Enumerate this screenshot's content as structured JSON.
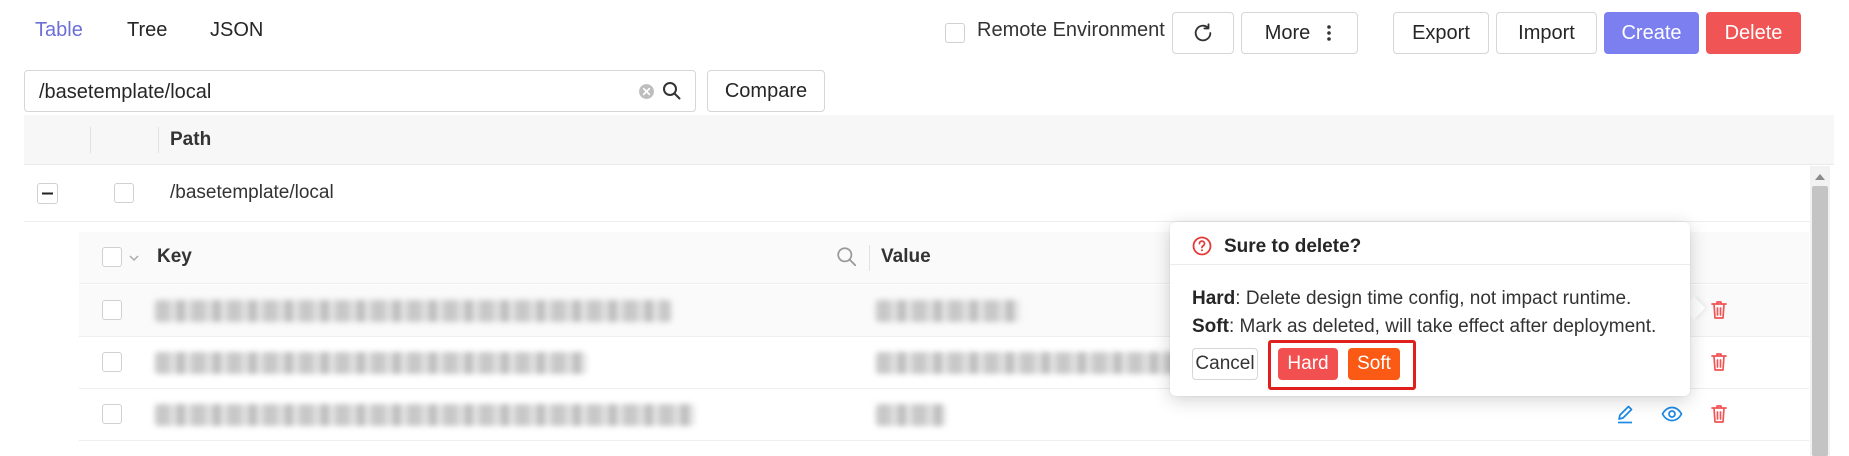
{
  "tabs": [
    {
      "label": "Table",
      "active": true
    },
    {
      "label": "Tree",
      "active": false
    },
    {
      "label": "JSON",
      "active": false
    }
  ],
  "toolbar": {
    "remote_env_label": "Remote Environment",
    "refresh_icon": "refresh-icon",
    "more_label": "More",
    "export_label": "Export",
    "import_label": "Import",
    "create_label": "Create",
    "delete_label": "Delete"
  },
  "search": {
    "value": "/basetemplate/local",
    "compare_label": "Compare"
  },
  "table": {
    "path_header": "Path",
    "group_path": "/basetemplate/local",
    "key_header": "Key",
    "value_header": "Value"
  },
  "popover": {
    "title": "Sure to delete?",
    "hard_term": "Hard",
    "hard_desc": ": Delete design time config, not impact runtime.",
    "soft_term": "Soft",
    "soft_desc": ": Mark as deleted, will take effect after deployment.",
    "cancel_label": "Cancel",
    "hard_label": "Hard",
    "soft_label": "Soft"
  },
  "colors": {
    "accent": "#7b7ff0",
    "danger": "#f05454",
    "soft_orange": "#fa5a14",
    "hard_red": "#f25050",
    "highlight": "#e0201e"
  }
}
